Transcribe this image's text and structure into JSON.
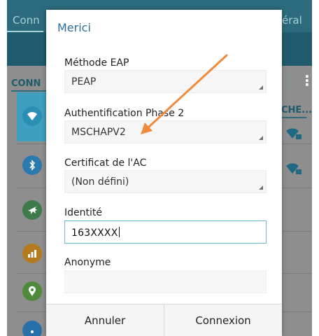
{
  "background": {
    "tab_left": "Conn",
    "tab_right": "éral",
    "section_title": "CONN",
    "right_label": "CHE...",
    "menu_glyph": "⋮",
    "icons": [
      "wifi-icon",
      "bluetooth-icon",
      "airplane-icon",
      "data-usage-icon",
      "location-icon",
      "hotspot-icon"
    ],
    "colors": {
      "tab_bar": "#2c6b7e",
      "action_bar": "#1f5b6c",
      "highlight": "#3f9fbf"
    }
  },
  "dialog": {
    "title": "Merici",
    "eap_method": {
      "label": "Méthode EAP",
      "value": "PEAP"
    },
    "phase2": {
      "label": "Authentification Phase 2",
      "value": "MSCHAPV2"
    },
    "ca_cert": {
      "label": "Certificat de l'AC",
      "value": "(Non défini)"
    },
    "identity": {
      "label": "Identité",
      "value": "163XXXX"
    },
    "anonymous": {
      "label": "Anonyme",
      "value": ""
    },
    "cancel_label": "Annuler",
    "connect_label": "Connexion"
  },
  "annotation": {
    "type": "arrow",
    "color": "#f08a3c",
    "target": "phase2"
  }
}
